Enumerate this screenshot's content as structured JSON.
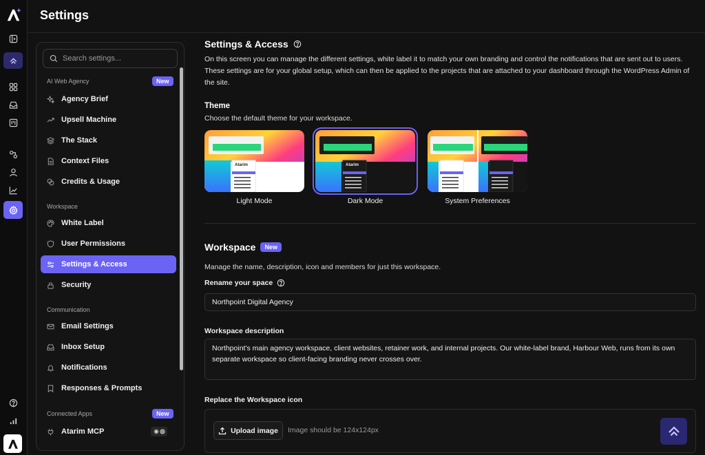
{
  "app": {
    "title": "Settings",
    "brand_color": "#6b63f4"
  },
  "rail": {
    "icons": [
      "atarim-logo",
      "panel-icon",
      "atarim-mark-icon",
      "grid-icon",
      "inbox-icon",
      "board-icon",
      "integrations-icon",
      "user-icon",
      "chart-icon",
      "gear-icon",
      "help-icon",
      "signal-icon",
      "atarim-logo"
    ]
  },
  "sidebar": {
    "search_placeholder": "Search settings...",
    "sections": [
      {
        "label": "AI Web Agency",
        "badge": "New",
        "items": [
          {
            "label": "Agency Brief",
            "icon": "sparkle-icon"
          },
          {
            "label": "Upsell Machine",
            "icon": "trend-icon"
          },
          {
            "label": "The Stack",
            "icon": "layers-icon"
          },
          {
            "label": "Context Files",
            "icon": "file-icon"
          },
          {
            "label": "Credits & Usage",
            "icon": "coins-icon"
          }
        ]
      },
      {
        "label": "Workspace",
        "items": [
          {
            "label": "White Label",
            "icon": "palette-icon"
          },
          {
            "label": "User Permissions",
            "icon": "shield-icon"
          },
          {
            "label": "Settings & Access",
            "icon": "sliders-icon",
            "active": true
          },
          {
            "label": "Security",
            "icon": "lock-icon"
          }
        ]
      },
      {
        "label": "Communication",
        "items": [
          {
            "label": "Email Settings",
            "icon": "mail-icon"
          },
          {
            "label": "Inbox Setup",
            "icon": "inbox-icon"
          },
          {
            "label": "Notifications",
            "icon": "bell-icon"
          },
          {
            "label": "Responses & Prompts",
            "icon": "bookmark-icon"
          }
        ]
      },
      {
        "label": "Connected Apps",
        "badge": "New",
        "items": [
          {
            "label": "Atarim MCP",
            "icon": "plug-icon"
          }
        ]
      }
    ]
  },
  "main": {
    "settings_access": {
      "title": "Settings & Access",
      "description": "On this screen you can manage the different settings, white label it to match your own branding and control the notifications that are sent out to users. These settings are for your global setup, which can then be applied to the projects that are attached to your dashboard through the WordPress Admin of the site."
    },
    "theme": {
      "title": "Theme",
      "description": "Choose the default theme for your workspace.",
      "preview_brand": "Atarim",
      "options": [
        {
          "label": "Light Mode",
          "selected": false
        },
        {
          "label": "Dark Mode",
          "selected": true
        },
        {
          "label": "System Preferences",
          "selected": false
        }
      ]
    },
    "workspace": {
      "title": "Workspace",
      "badge": "New",
      "description": "Manage the name, description, icon and members for just this workspace.",
      "rename_label": "Rename your space",
      "name_value": "Northpoint Digital Agency",
      "description_label": "Workspace description",
      "description_value": "Northpoint's main agency workspace, client websites, retainer work, and internal projects. Our white-label brand, Harbour Web, runs from its own separate workspace so client-facing branding never crosses over.",
      "icon_label": "Replace the Workspace icon",
      "upload_label": "Upload image",
      "upload_hint": "Image should be 124x124px"
    }
  }
}
